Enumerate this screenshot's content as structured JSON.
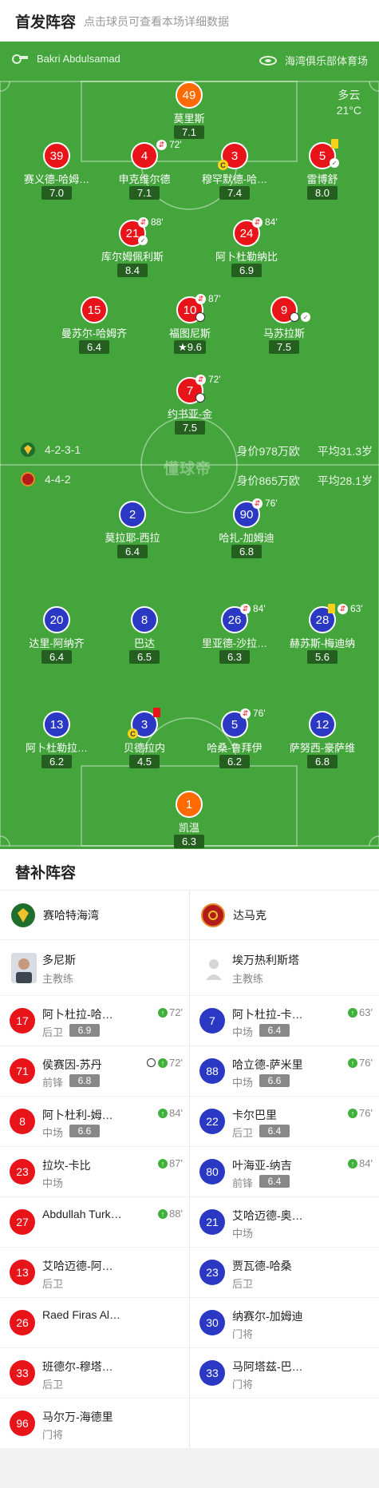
{
  "header": {
    "title": "首发阵容",
    "subtitle": "点击球员可查看本场详细数据"
  },
  "pitch": {
    "referee": "Bakri Abdulsamad",
    "venue": "海湾俱乐部体育场",
    "weather": "多云",
    "temperature": "21°C",
    "watermark": "懂球帝"
  },
  "home": {
    "formation": "4-2-3-1",
    "value": "身价978万欧",
    "age": "平均31.3岁",
    "color": "#e8141a",
    "players": [
      {
        "num": "49",
        "name": "莫里斯",
        "rating": "7.1",
        "gk": true
      },
      {
        "num": "39",
        "name": "赛义德-哈姆…",
        "rating": "7.0"
      },
      {
        "num": "4",
        "name": "申克维尔德",
        "rating": "7.1",
        "sub_min": "72'"
      },
      {
        "num": "3",
        "name": "穆罕默德-哈…",
        "rating": "7.4"
      },
      {
        "num": "5",
        "name": "雷博舒",
        "rating": "8.0"
      },
      {
        "num": "21",
        "name": "库尔姆佩利斯",
        "rating": "8.4",
        "sub_min": "88'"
      },
      {
        "num": "24",
        "name": "阿卜杜勒纳比",
        "rating": "6.9",
        "sub_min": "84'"
      },
      {
        "num": "15",
        "name": "曼苏尔-哈姆齐",
        "rating": "6.4"
      },
      {
        "num": "10",
        "name": "福图尼斯",
        "rating": "9.6",
        "sub_min": "87'"
      },
      {
        "num": "9",
        "name": "马苏拉斯",
        "rating": "7.5"
      },
      {
        "num": "7",
        "name": "约书亚-金",
        "rating": "7.5",
        "sub_min": "72'"
      }
    ]
  },
  "away": {
    "formation": "4-4-2",
    "value": "身价865万欧",
    "age": "平均28.1岁",
    "color": "#2b38c4",
    "players": [
      {
        "num": "2",
        "name": "莫拉耶-西拉",
        "rating": "6.4"
      },
      {
        "num": "90",
        "name": "哈扎-加姆迪",
        "rating": "6.8",
        "sub_min": "76'"
      },
      {
        "num": "20",
        "name": "达里-阿纳齐",
        "rating": "6.4"
      },
      {
        "num": "8",
        "name": "巴达",
        "rating": "6.5"
      },
      {
        "num": "26",
        "name": "里亚德-沙拉…",
        "rating": "6.3",
        "sub_min": "84'"
      },
      {
        "num": "28",
        "name": "赫苏斯-梅迪纳",
        "rating": "5.6",
        "sub_min": "63'"
      },
      {
        "num": "13",
        "name": "阿卜杜勒拉…",
        "rating": "6.2"
      },
      {
        "num": "3",
        "name": "贝德拉内",
        "rating": "4.5"
      },
      {
        "num": "5",
        "name": "哈桑-鲁拜伊",
        "rating": "6.2",
        "sub_min": "76'"
      },
      {
        "num": "12",
        "name": "萨努西-豪萨维",
        "rating": "6.8"
      },
      {
        "num": "1",
        "name": "凯温",
        "rating": "6.3",
        "gk": true
      }
    ]
  },
  "subs": {
    "title": "替补阵容",
    "home_team": "赛哈特海湾",
    "away_team": "达马克",
    "home_coach": {
      "name": "多尼斯",
      "role": "主教练"
    },
    "away_coach": {
      "name": "埃万热利斯塔",
      "role": "主教练"
    },
    "home_list": [
      {
        "num": "17",
        "name": "阿卜杜拉-哈…",
        "pos": "后卫",
        "rating": "6.9",
        "in": "72'"
      },
      {
        "num": "71",
        "name": "侯赛因-苏丹",
        "pos": "前锋",
        "rating": "6.8",
        "in": "72'",
        "goal": true
      },
      {
        "num": "8",
        "name": "阿卜杜利-姆…",
        "pos": "中场",
        "rating": "6.6",
        "in": "84'"
      },
      {
        "num": "23",
        "name": "拉坎-卡比",
        "pos": "中场",
        "rating": "",
        "in": "87'"
      },
      {
        "num": "27",
        "name": "Abdullah Turk…",
        "pos": "",
        "rating": "",
        "in": "88'"
      },
      {
        "num": "13",
        "name": "艾哈迈德-阿…",
        "pos": "后卫",
        "rating": "",
        "in": ""
      },
      {
        "num": "26",
        "name": "Raed Firas Al…",
        "pos": "",
        "rating": "",
        "in": ""
      },
      {
        "num": "33",
        "name": "班德尔-穆塔…",
        "pos": "后卫",
        "rating": "",
        "in": ""
      },
      {
        "num": "96",
        "name": "马尔万-海德里",
        "pos": "门将",
        "rating": "",
        "in": ""
      }
    ],
    "away_list": [
      {
        "num": "7",
        "name": "阿卜杜拉-卡…",
        "pos": "中场",
        "rating": "6.4",
        "in": "63'"
      },
      {
        "num": "88",
        "name": "哈立德-萨米里",
        "pos": "中场",
        "rating": "6.6",
        "in": "76'"
      },
      {
        "num": "22",
        "name": "卡尔巴里",
        "pos": "后卫",
        "rating": "6.4",
        "in": "76'"
      },
      {
        "num": "80",
        "name": "叶海亚-纳吉",
        "pos": "前锋",
        "rating": "6.4",
        "in": "84'"
      },
      {
        "num": "21",
        "name": "艾哈迈德-奥…",
        "pos": "中场",
        "rating": "",
        "in": ""
      },
      {
        "num": "23",
        "name": "贾瓦德-哈桑",
        "pos": "后卫",
        "rating": "",
        "in": ""
      },
      {
        "num": "30",
        "name": "纳赛尔-加姆迪",
        "pos": "门将",
        "rating": "",
        "in": ""
      },
      {
        "num": "33",
        "name": "马阿塔兹-巴…",
        "pos": "门将",
        "rating": "",
        "in": ""
      }
    ]
  }
}
